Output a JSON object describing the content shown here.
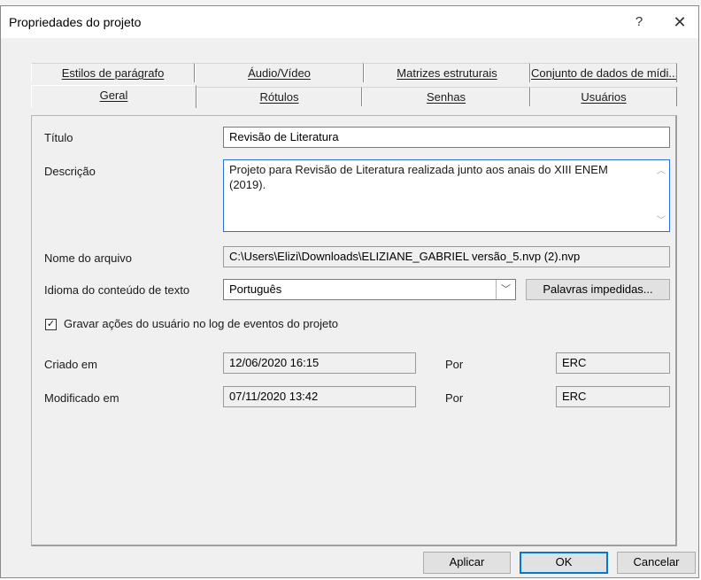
{
  "window": {
    "title": "Propriedades do projeto",
    "help_glyph": "?",
    "close_glyph": "✕"
  },
  "tabs_back": [
    {
      "label": "Estilos de parágrafo"
    },
    {
      "label": "Áudio/Vídeo"
    },
    {
      "label": "Matrizes estruturais"
    },
    {
      "label": "Conjunto de dados de mídi..."
    }
  ],
  "tabs_front": [
    {
      "label": "Geral",
      "active": true
    },
    {
      "label": "Rótulos"
    },
    {
      "label": "Senhas"
    },
    {
      "label": "Usuários"
    }
  ],
  "form": {
    "title_label": "Título",
    "title_value": "Revisão de Literatura",
    "description_label": "Descrição",
    "description_value": "Projeto para Revisão de Literatura  realizada junto aos anais do XIII ENEM (2019).",
    "filename_label": "Nome do arquivo",
    "filename_value": "C:\\Users\\Elizi\\Downloads\\ELIZIANE_GABRIEL versão_5.nvp (2).nvp",
    "language_label": "Idioma do conteúdo de texto",
    "language_value": "Português",
    "stop_words_button": "Palavras impedidas...",
    "log_checkbox_label": "Gravar ações do usuário no log de eventos do projeto",
    "log_checkbox_checked": true,
    "created_label": "Criado em",
    "created_value": "12/06/2020 16:15",
    "created_by_label": "Por",
    "created_by_value": "ERC",
    "modified_label": "Modificado em",
    "modified_value": "07/11/2020 13:42",
    "modified_by_label": "Por",
    "modified_by_value": "ERC"
  },
  "buttons": {
    "apply": "Aplicar",
    "ok": "OK",
    "cancel": "Cancelar"
  },
  "icons": {
    "scroll_up": "scroll-up-icon",
    "scroll_down": "scroll-down-icon",
    "combo": "chevron-down-icon",
    "check": "checkmark-icon"
  }
}
